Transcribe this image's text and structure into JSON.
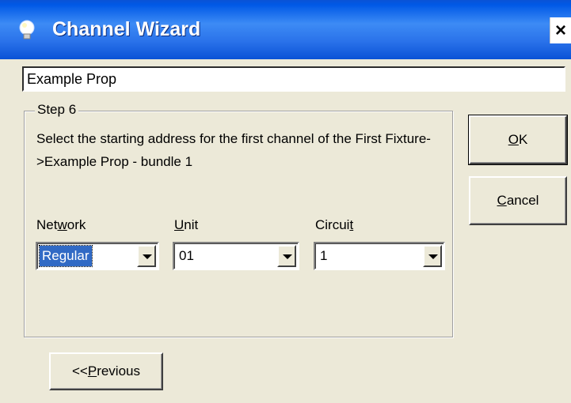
{
  "window": {
    "title": "Channel Wizard",
    "close_glyph": "×",
    "icon": "lightbulb-icon"
  },
  "name_field": {
    "value": "Example Prop"
  },
  "step": {
    "legend": "Step 6",
    "description": "Select the starting address for the first channel of the First Fixture->Example Prop - bundle 1"
  },
  "fields": {
    "network": {
      "label_pre": "Net",
      "label_accel": "w",
      "label_post": "ork",
      "value": "Regular"
    },
    "unit": {
      "label_pre": "",
      "label_accel": "U",
      "label_post": "nit",
      "value": "01"
    },
    "circuit": {
      "label_pre": "Circui",
      "label_accel": "t",
      "label_post": "",
      "value": "1"
    }
  },
  "buttons": {
    "ok": {
      "accel": "O",
      "rest": "K"
    },
    "cancel": {
      "accel": "C",
      "rest": "ancel"
    },
    "previous": {
      "pre": "<< ",
      "accel": "P",
      "rest": "revious"
    }
  },
  "colors": {
    "titlebar": "#2a72ea",
    "dialog_bg": "#ece9d8",
    "selection": "#316ac5"
  }
}
